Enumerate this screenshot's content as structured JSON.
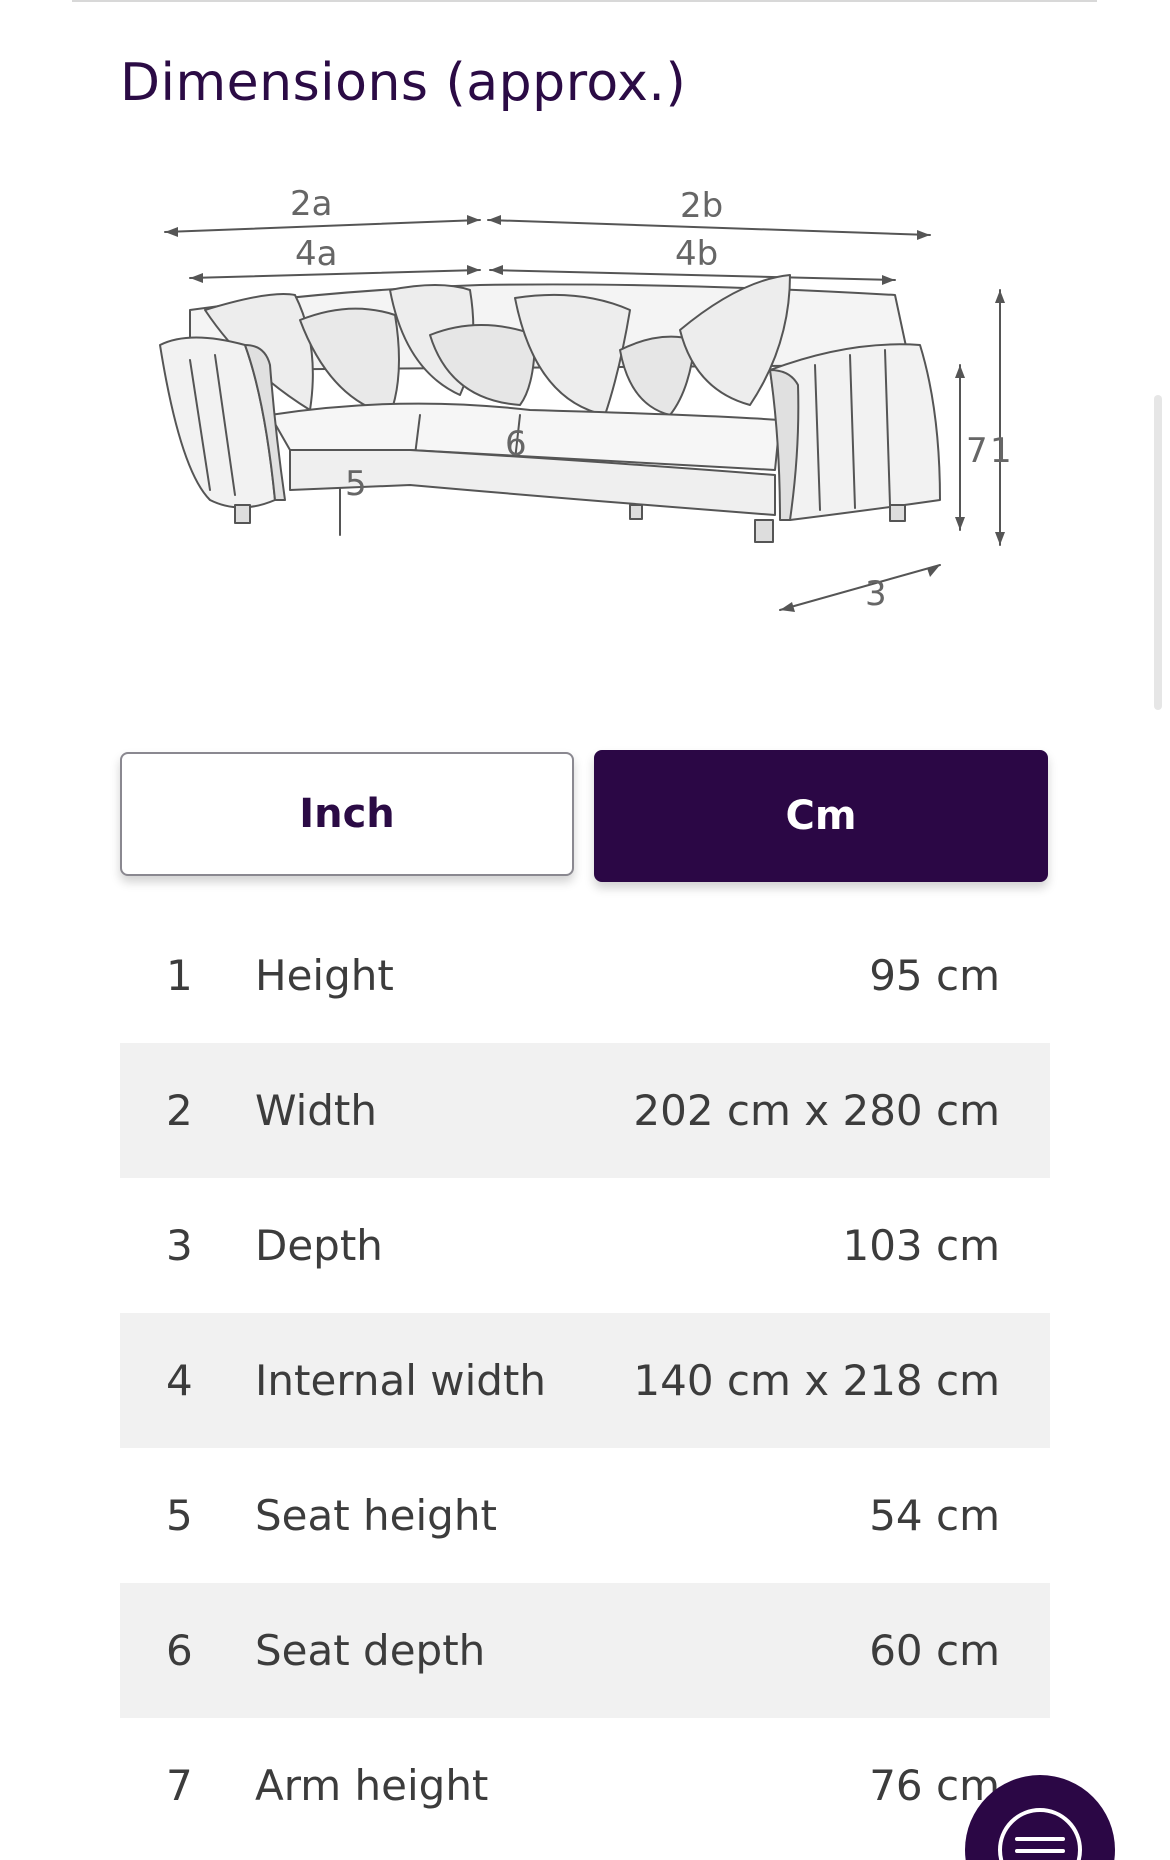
{
  "section": {
    "title": "Dimensions (approx.)"
  },
  "diagram": {
    "labels": [
      "2a",
      "2b",
      "4a",
      "4b",
      "1",
      "7",
      "6",
      "5",
      "3"
    ]
  },
  "unit_toggle": {
    "options": [
      {
        "label": "Inch",
        "selected": false
      },
      {
        "label": "Cm",
        "selected": true
      }
    ]
  },
  "dimensions": {
    "rows": [
      {
        "num": "1",
        "label": "Height",
        "value": "95 cm"
      },
      {
        "num": "2",
        "label": "Width",
        "value": "202 cm x 280 cm"
      },
      {
        "num": "3",
        "label": "Depth",
        "value": "103 cm"
      },
      {
        "num": "4",
        "label": "Internal width",
        "value": "140 cm x 218 cm"
      },
      {
        "num": "5",
        "label": "Seat height",
        "value": "54 cm"
      },
      {
        "num": "6",
        "label": "Seat depth",
        "value": "60 cm"
      },
      {
        "num": "7",
        "label": "Arm height",
        "value": "76 cm"
      }
    ]
  },
  "colors": {
    "brand": "#2b0745",
    "row_shade": "#f1f1f1",
    "text": "#3c3c3c"
  },
  "icons": {
    "chat": "chat-menu-icon"
  }
}
